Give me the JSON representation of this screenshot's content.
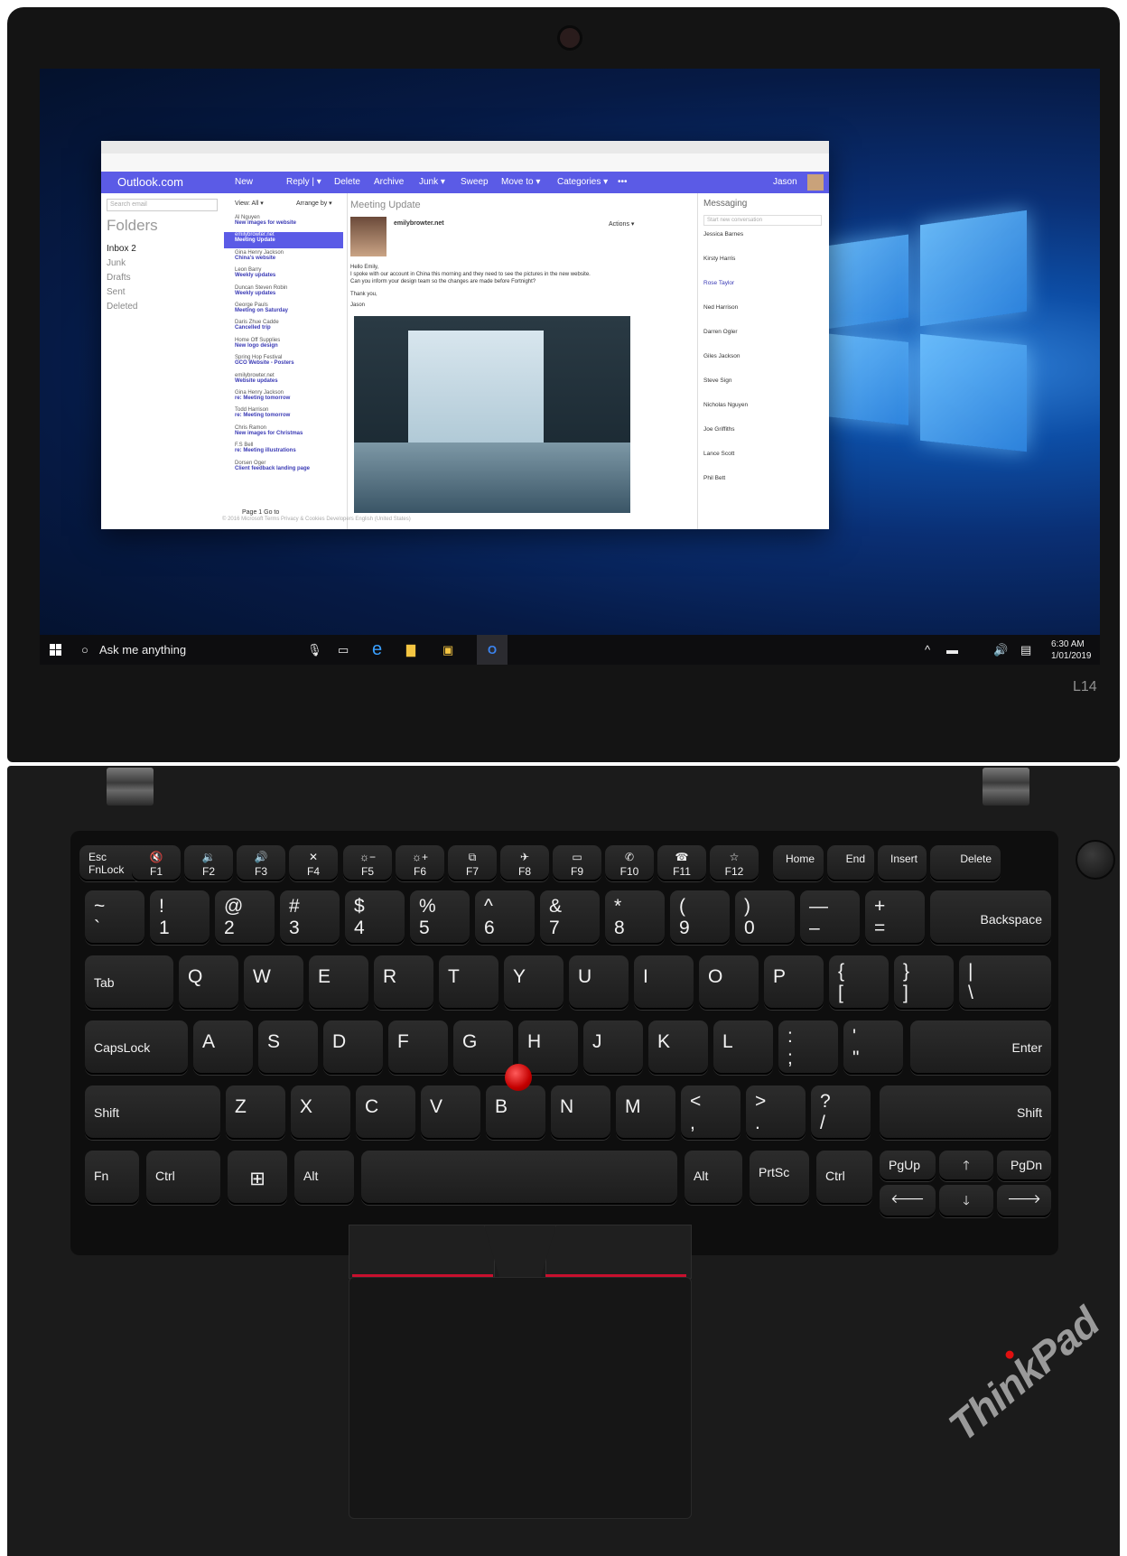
{
  "brand_model": "L14",
  "brand_logo_text": "ThinkPad",
  "taskbar": {
    "search_placeholder": "Ask me anything",
    "time": "6:30 AM",
    "date": "1/01/2019"
  },
  "outlook": {
    "logo_text": "Outlook.com",
    "toolbar": [
      "New",
      "Reply | ▾",
      "Delete",
      "Archive",
      "Junk ▾",
      "Sweep",
      "Move to ▾",
      "Categories ▾",
      "•••"
    ],
    "user": "Jason",
    "search_placeholder": "Search email",
    "folders_heading": "Folders",
    "folders": [
      "Inbox  2",
      "Junk",
      "Drafts",
      "Sent",
      "Deleted"
    ],
    "list_header_view": "View: All ▾",
    "list_header_arrange": "Arrange by ▾",
    "messages": [
      {
        "from": "Al Nguyen",
        "subject": "New images for website"
      },
      {
        "from": "emilybrowter.net",
        "subject": "Meeting Update"
      },
      {
        "from": "Gina Henry Jackson",
        "subject": "China's website"
      },
      {
        "from": "Leon Barry",
        "subject": "Weekly updates"
      },
      {
        "from": "Duncan Steven Robin",
        "subject": "Weekly updates"
      },
      {
        "from": "George Pauls",
        "subject": "Meeting on Saturday"
      },
      {
        "from": "Daris Zhue Cadde",
        "subject": "Cancelled trip"
      },
      {
        "from": "Home Off Supplies",
        "subject": "New logo design"
      },
      {
        "from": "Spring Hop Festival",
        "subject": "GCO Website - Posters"
      },
      {
        "from": "emilybrowter.net",
        "subject": "Website updates"
      },
      {
        "from": "Gina Henry Jackson",
        "subject": "re: Meeting tomorrow"
      },
      {
        "from": "Todd Harrison",
        "subject": "re: Meeting tomorrow"
      },
      {
        "from": "Chris Ramon",
        "subject": "New images for Christmas"
      },
      {
        "from": "F.S Bell",
        "subject": "re: Meeting illustrations"
      },
      {
        "from": "Dorsen Oger",
        "subject": "Client feedback landing page"
      }
    ],
    "pager": "Page 1   Go to",
    "reading_title": "Meeting Update",
    "reading_from": "emilybrowter.net",
    "reading_actions": "Actions ▾",
    "body_lines": [
      "Hello Emily,",
      "I spoke with our account in China this morning and they need to see the pictures in the new website.",
      "Can you inform your design team so the changes are made before Fortnight?",
      "Thank you,",
      "Jason"
    ],
    "footer": "© 2016 Microsoft   Terms   Privacy & Cookies   Developers   English (United States)",
    "messaging_title": "Messaging",
    "messaging_placeholder": "Start new conversation",
    "contacts": [
      "Jessica Barnes",
      "Kirsty Harris",
      "Rose Taylor",
      "Ned Harrison",
      "Darren Ogler",
      "Giles Jackson",
      "Steve Sign",
      "Nicholas Nguyen",
      "Joe Griffiths",
      "Lance Scott",
      "Phil Bett"
    ]
  },
  "keys": {
    "fn_row": [
      {
        "top": "Esc",
        "bottom": "FnLock"
      },
      {
        "top": "🔇",
        "bottom": "F1"
      },
      {
        "top": "🔉",
        "bottom": "F2"
      },
      {
        "top": "🔊",
        "bottom": "F3"
      },
      {
        "top": "✕",
        "bottom": "F4"
      },
      {
        "top": "☼−",
        "bottom": "F5"
      },
      {
        "top": "☼+",
        "bottom": "F6"
      },
      {
        "top": "⧉",
        "bottom": "F7"
      },
      {
        "top": "✈",
        "bottom": "F8"
      },
      {
        "top": "▭",
        "bottom": "F9"
      },
      {
        "top": "✆",
        "bottom": "F10"
      },
      {
        "top": "☎",
        "bottom": "F11"
      },
      {
        "top": "☆",
        "bottom": "F12"
      },
      {
        "top": "Home",
        "bottom": ""
      },
      {
        "top": "End",
        "bottom": ""
      },
      {
        "top": "Insert",
        "bottom": ""
      },
      {
        "top": "Delete",
        "bottom": ""
      }
    ],
    "num_row": [
      {
        "top": "~",
        "bottom": "`"
      },
      {
        "top": "!",
        "bottom": "1"
      },
      {
        "top": "@",
        "bottom": "2"
      },
      {
        "top": "#",
        "bottom": "3"
      },
      {
        "top": "$",
        "bottom": "4"
      },
      {
        "top": "%",
        "bottom": "5"
      },
      {
        "top": "^",
        "bottom": "6"
      },
      {
        "top": "&",
        "bottom": "7"
      },
      {
        "top": "*",
        "bottom": "8"
      },
      {
        "top": "(",
        "bottom": "9"
      },
      {
        "top": ")",
        "bottom": "0"
      },
      {
        "top": "—",
        "bottom": "–"
      },
      {
        "top": "+",
        "bottom": "="
      },
      {
        "top": "Backspace",
        "bottom": ""
      }
    ],
    "row_q": [
      "Tab",
      "Q",
      "W",
      "E",
      "R",
      "T",
      "Y",
      "U",
      "I",
      "O",
      "P",
      "{ [",
      "} ]",
      "| \\"
    ],
    "row_a": [
      "CapsLock",
      "A",
      "S",
      "D",
      "F",
      "G",
      "H",
      "J",
      "K",
      "L",
      "; :",
      "\" '",
      "Enter"
    ],
    "row_z": [
      "Shift",
      "Z",
      "X",
      "C",
      "V",
      "B",
      "N",
      "M",
      "< ,",
      "> .",
      "? /",
      "Shift"
    ],
    "row_bottom": [
      "Fn",
      "Ctrl",
      "⊞",
      "Alt",
      "",
      "Alt",
      "PrtSc",
      "Ctrl"
    ],
    "arrows": {
      "pgup": "PgUp",
      "pgdn": "PgDn",
      "up": "🡑",
      "down": "🡓",
      "left": "🡐",
      "right": "🡒"
    }
  }
}
